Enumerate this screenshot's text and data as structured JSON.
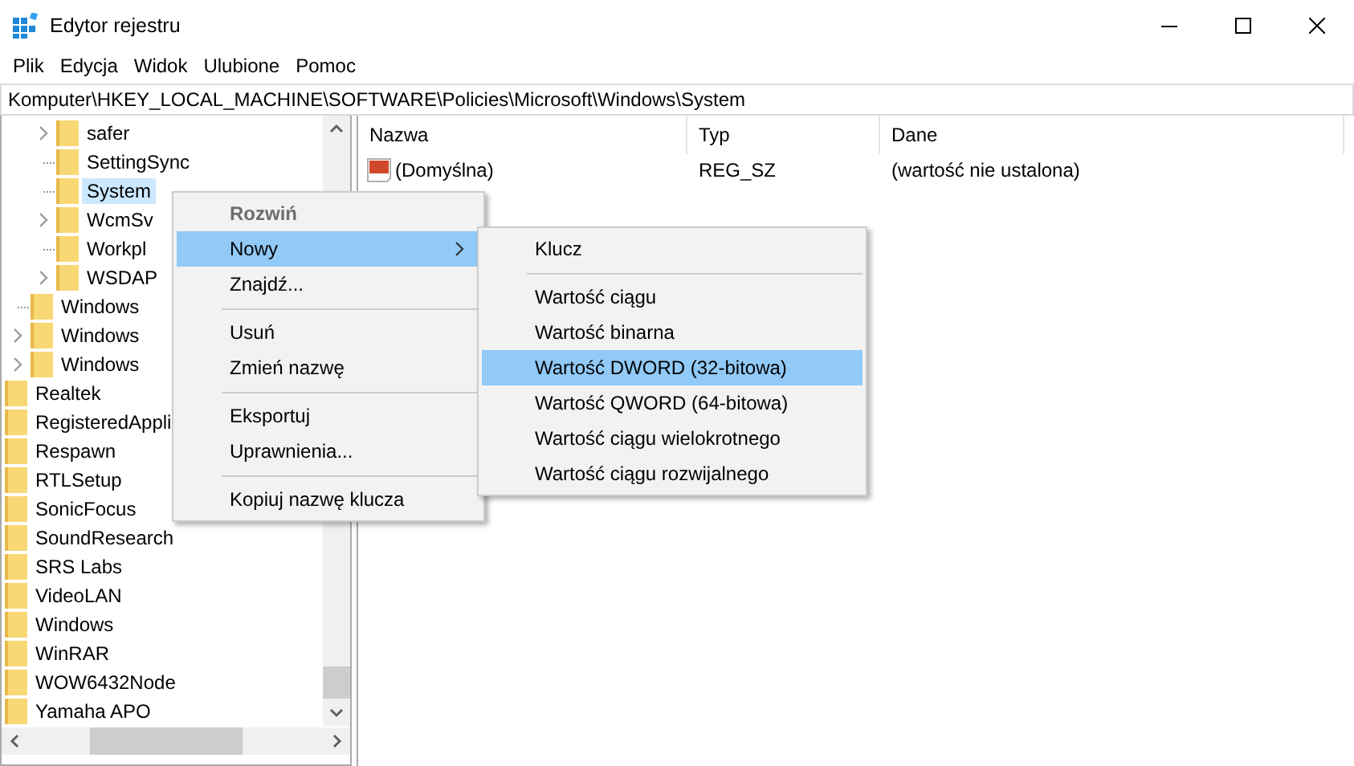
{
  "window": {
    "title": "Edytor rejestru"
  },
  "menu_bar": [
    "Plik",
    "Edycja",
    "Widok",
    "Ulubione",
    "Pomoc"
  ],
  "address": "Komputer\\HKEY_LOCAL_MACHINE\\SOFTWARE\\Policies\\Microsoft\\Windows\\System",
  "tree": [
    {
      "children": [
        {
          "children": [
            {
              "label": "safer",
              "expanded": false,
              "selected": false
            },
            {
              "label": "SettingSync",
              "selected": false
            },
            {
              "label": "System",
              "selected": true
            },
            {
              "label": "WcmSv",
              "expanded": false,
              "selected": false
            },
            {
              "label": "Workpl",
              "selected": false
            },
            {
              "label": "WSDAP",
              "expanded": false,
              "selected": false
            }
          ]
        },
        {
          "label": "Windows",
          "selected": false
        },
        {
          "label": "Windows",
          "expanded": false,
          "selected": false
        },
        {
          "label": "Windows",
          "expanded": false,
          "selected": false
        }
      ]
    },
    {
      "label": "Realtek",
      "selected": false
    },
    {
      "label": "RegisteredAppli",
      "selected": false
    },
    {
      "label": "Respawn",
      "selected": false
    },
    {
      "label": "RTLSetup",
      "selected": false
    },
    {
      "label": "SonicFocus",
      "selected": false
    },
    {
      "label": "SoundResearch",
      "selected": false
    },
    {
      "label": "SRS Labs",
      "selected": false
    },
    {
      "label": "VideoLAN",
      "selected": false
    },
    {
      "label": "Windows",
      "selected": false
    },
    {
      "label": "WinRAR",
      "selected": false
    },
    {
      "label": "WOW6432Node",
      "selected": false
    },
    {
      "label": "Yamaha APO",
      "selected": false
    }
  ],
  "table": {
    "columns": [
      "Nazwa",
      "Typ",
      "Dane"
    ],
    "rows": [
      {
        "name": "(Domyślna)",
        "type": "REG_SZ",
        "data": "(wartość nie ustalona)"
      }
    ]
  },
  "context_menu": [
    {
      "kind": "item",
      "label": "Rozwiń",
      "disabled": true,
      "selected": false
    },
    {
      "kind": "item",
      "label": "Nowy",
      "submenu": true,
      "selected": true
    },
    {
      "kind": "item",
      "label": "Znajdź...",
      "selected": false
    },
    {
      "kind": "separator"
    },
    {
      "kind": "item",
      "label": "Usuń",
      "selected": false
    },
    {
      "kind": "item",
      "label": "Zmień nazwę",
      "selected": false
    },
    {
      "kind": "separator"
    },
    {
      "kind": "item",
      "label": "Eksportuj",
      "selected": false
    },
    {
      "kind": "item",
      "label": "Uprawnienia...",
      "selected": false
    },
    {
      "kind": "separator"
    },
    {
      "kind": "item",
      "label": "Kopiuj nazwę klucza",
      "selected": false
    }
  ],
  "submenu": [
    {
      "kind": "item",
      "label": "Klucz",
      "selected": false
    },
    {
      "kind": "separator"
    },
    {
      "kind": "item",
      "label": "Wartość ciągu",
      "selected": false
    },
    {
      "kind": "item",
      "label": "Wartość binarna",
      "selected": false
    },
    {
      "kind": "item",
      "label": "Wartość DWORD (32-bitowa)",
      "selected": true
    },
    {
      "kind": "item",
      "label": "Wartość QWORD (64-bitowa)",
      "selected": false
    },
    {
      "kind": "item",
      "label": "Wartość ciągu wielokrotnego",
      "selected": false
    },
    {
      "kind": "item",
      "label": "Wartość ciągu rozwijalnego",
      "selected": false
    }
  ]
}
